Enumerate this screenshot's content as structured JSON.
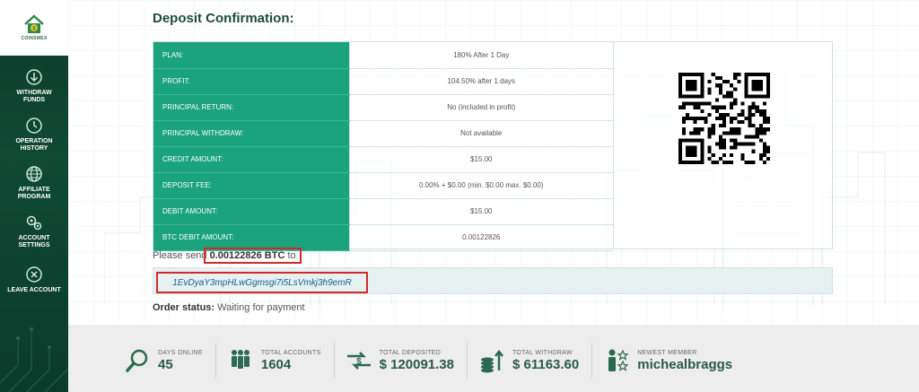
{
  "brand": {
    "name": "COINSMEX",
    "accent": "#1aa37c",
    "sidebar_bg": "#0f4a35"
  },
  "sidebar": {
    "items": [
      {
        "label": "WITHDRAW FUNDS",
        "icon": "withdraw-icon"
      },
      {
        "label": "OPERATION HISTORY",
        "icon": "history-icon"
      },
      {
        "label": "AFFILIATE PROGRAM",
        "icon": "globe-icon"
      },
      {
        "label": "ACCOUNT SETTINGS",
        "icon": "gears-icon"
      },
      {
        "label": "LEAVE ACCOUNT",
        "icon": "logout-icon"
      }
    ]
  },
  "main": {
    "title": "Deposit Confirmation:",
    "rows": [
      {
        "key": "PLAN:",
        "value": "180% After 1 Day"
      },
      {
        "key": "PROFIT:",
        "value": "104.50% after 1 days"
      },
      {
        "key": "PRINCIPAL RETURN:",
        "value": "No (included in profit)"
      },
      {
        "key": "PRINCIPAL WITHDRAW:",
        "value": "Not available"
      },
      {
        "key": "CREDIT AMOUNT:",
        "value": "$15.00"
      },
      {
        "key": "DEPOSIT FEE:",
        "value": "0.00% + $0.00 (min. $0.00 max. $0.00)"
      },
      {
        "key": "DEBIT AMOUNT:",
        "value": "$15.00"
      },
      {
        "key": "BTC DEBIT AMOUNT:",
        "value": "0.00122826"
      }
    ],
    "send_prefix": "Please send",
    "send_amount": "0.00122826 BTC",
    "send_suffix": "to",
    "btc_address": "1EvDyaY3mpHLwGgmsgi7i5LsVmkj3h9emR",
    "order_status_label": "Order status:",
    "order_status_value": "Waiting for payment"
  },
  "stats": [
    {
      "label": "DAYS ONLINE",
      "value": "45",
      "icon": "magnifier-icon"
    },
    {
      "label": "TOTAL ACCOUNTS",
      "value": "1604",
      "icon": "people-icon"
    },
    {
      "label": "TOTAL DEPOSITED",
      "value": "$ 120091.38",
      "icon": "transfer-icon"
    },
    {
      "label": "TOTAL WITHDRAW",
      "value": "$ 61163.60",
      "icon": "coins-icon"
    },
    {
      "label": "NEWEST MEMBER",
      "value": "michealbraggs",
      "icon": "member-icon"
    }
  ]
}
